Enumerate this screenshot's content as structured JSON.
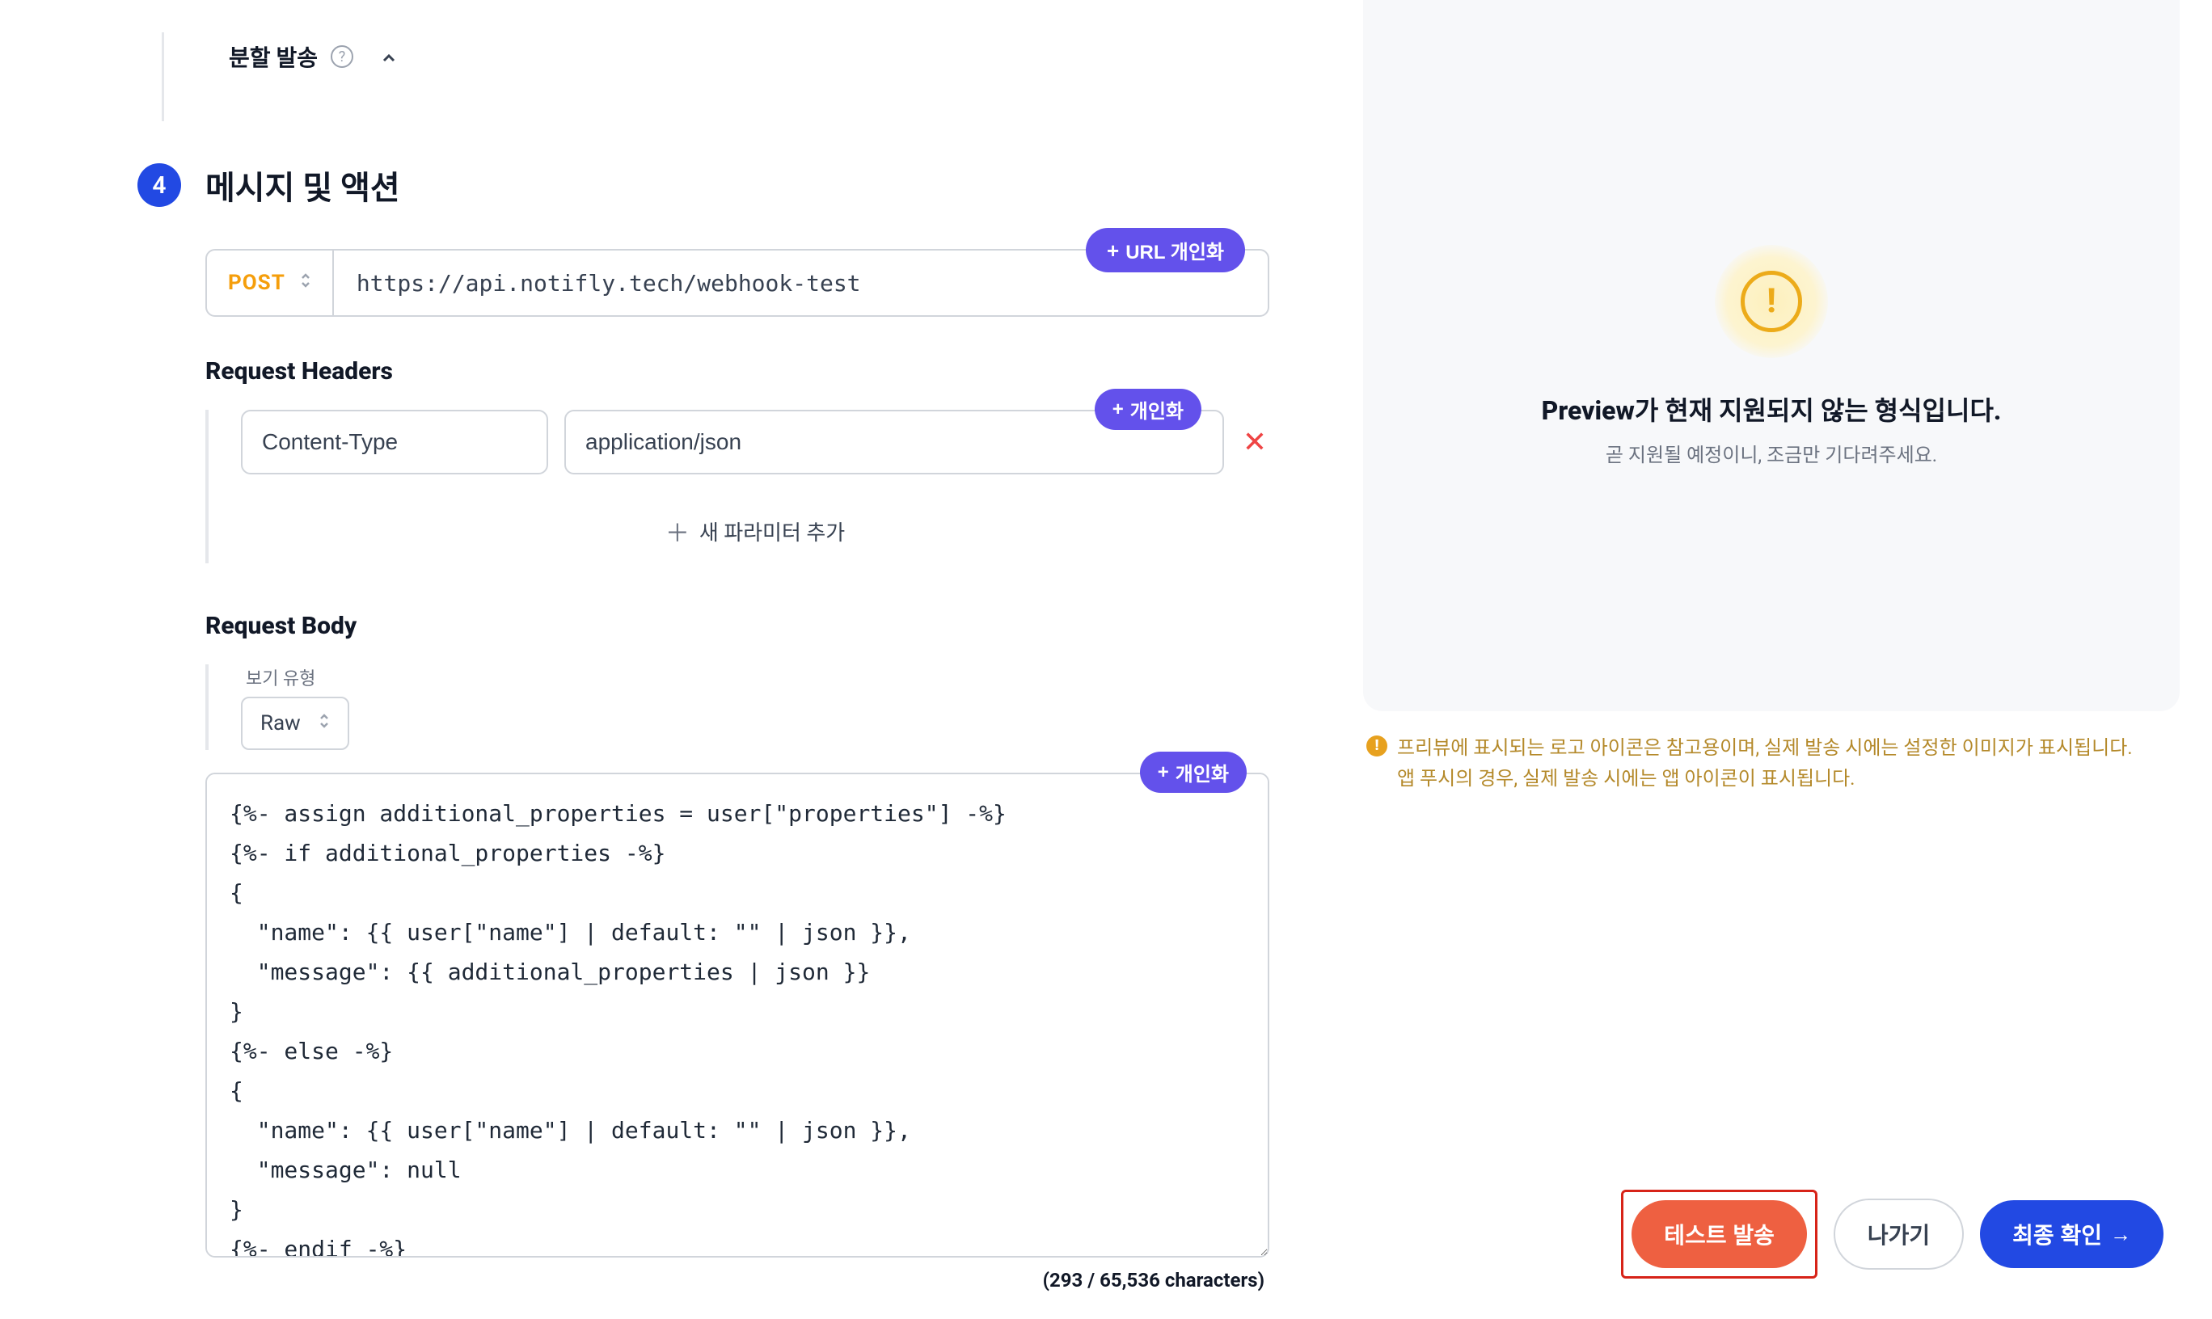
{
  "splitSend": {
    "label": "분할 발송"
  },
  "section4": {
    "step": "4",
    "title": "메시지 및 액션"
  },
  "url": {
    "method": "POST",
    "value": "https://api.notifly.tech/webhook-test",
    "personalize_label": "URL 개인화"
  },
  "headers": {
    "title": "Request Headers",
    "personalize_label": "개인화",
    "rows": [
      {
        "key": "Content-Type",
        "value": "application/json"
      }
    ],
    "add_param_label": "새 파라미터 추가"
  },
  "body": {
    "title": "Request Body",
    "view_type_label": "보기 유형",
    "view_type_value": "Raw",
    "personalize_label": "개인화",
    "content": "{%- assign additional_properties = user[\"properties\"] -%}\n{%- if additional_properties -%}\n{\n  \"name\": {{ user[\"name\"] | default: \"\" | json }},\n  \"message\": {{ additional_properties | json }}\n}\n{%- else -%}\n{\n  \"name\": {{ user[\"name\"] | default: \"\" | json }},\n  \"message\": null\n}\n{%- endif -%}",
    "char_count": "(293 / 65,536 characters)"
  },
  "preview": {
    "title": "Preview가 현재 지원되지 않는 형식입니다.",
    "sub": "곧 지원될 예정이니, 조금만 기다려주세요.",
    "notice_line1": "프리뷰에 표시되는 로고 아이콘은 참고용이며, 실제 발송 시에는 설정한 이미지가 표시됩니다.",
    "notice_line2": "앱 푸시의 경우, 실제 발송 시에는 앱 아이콘이 표시됩니다."
  },
  "actions": {
    "test": "테스트 발송",
    "exit": "나가기",
    "confirm": "최종 확인"
  }
}
